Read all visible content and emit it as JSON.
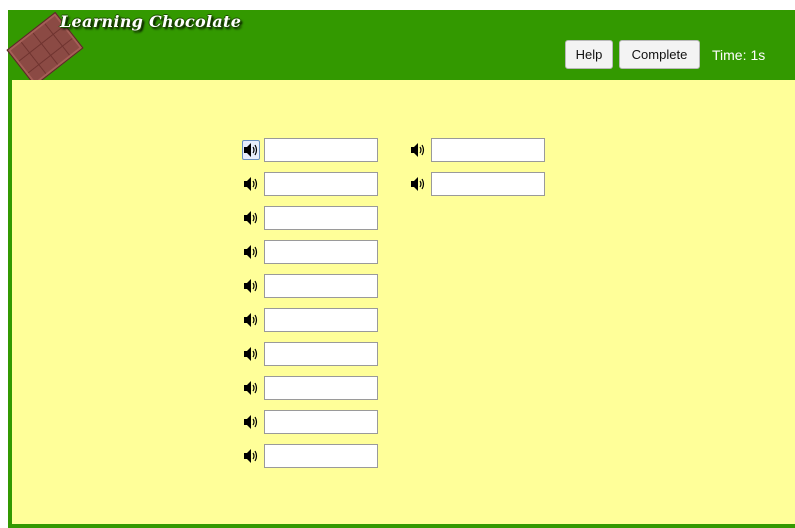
{
  "header": {
    "logo_text": "Learning Chocolate",
    "help_label": "Help",
    "complete_label": "Complete",
    "time_label": "Time:",
    "time_value": "1s"
  },
  "colors": {
    "header_green": "#339900",
    "content_yellow": "#ffff99"
  },
  "icons": {
    "logo": "chocolate-bar-icon",
    "audio": "speaker-icon"
  },
  "left_column": [
    {
      "value": ""
    },
    {
      "value": ""
    },
    {
      "value": ""
    },
    {
      "value": ""
    },
    {
      "value": ""
    },
    {
      "value": ""
    },
    {
      "value": ""
    },
    {
      "value": ""
    },
    {
      "value": ""
    },
    {
      "value": ""
    }
  ],
  "right_column": [
    {
      "value": ""
    },
    {
      "value": ""
    }
  ]
}
